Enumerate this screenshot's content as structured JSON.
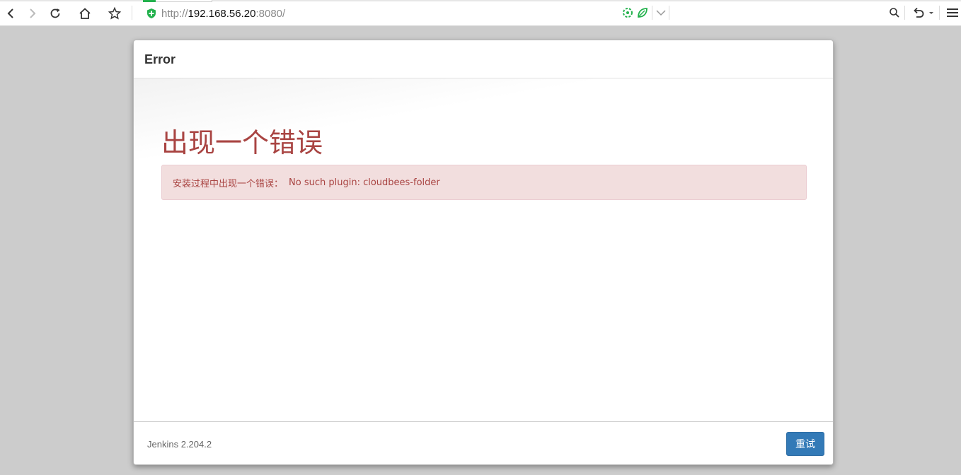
{
  "browser": {
    "url": {
      "scheme": "http://",
      "host": "192.168.56.20",
      "rest": ":8080/"
    },
    "icons": {
      "back": "back-arrow-icon",
      "forward": "forward-arrow-icon",
      "reload": "reload-icon",
      "home": "home-icon",
      "bookmark": "star-icon",
      "security": "shield-icon",
      "extension1": "green-extension-icon",
      "extension2": "leaf-extension-icon",
      "dropdown": "chevron-down-icon",
      "search": "search-icon",
      "undo": "undo-icon",
      "menu": "hamburger-menu-icon"
    },
    "accent_green": "#22b14c"
  },
  "dialog": {
    "title": "Error",
    "heading": "出现一个错误",
    "alert": {
      "prefix": "安装过程中出现一个错误：",
      "message": "No such plugin: cloudbees-folder"
    },
    "footer": {
      "version": "Jenkins 2.204.2",
      "retry_label": "重试"
    },
    "colors": {
      "error_text": "#a94442",
      "alert_bg": "#f2dede",
      "primary_button": "#337ab7"
    }
  }
}
